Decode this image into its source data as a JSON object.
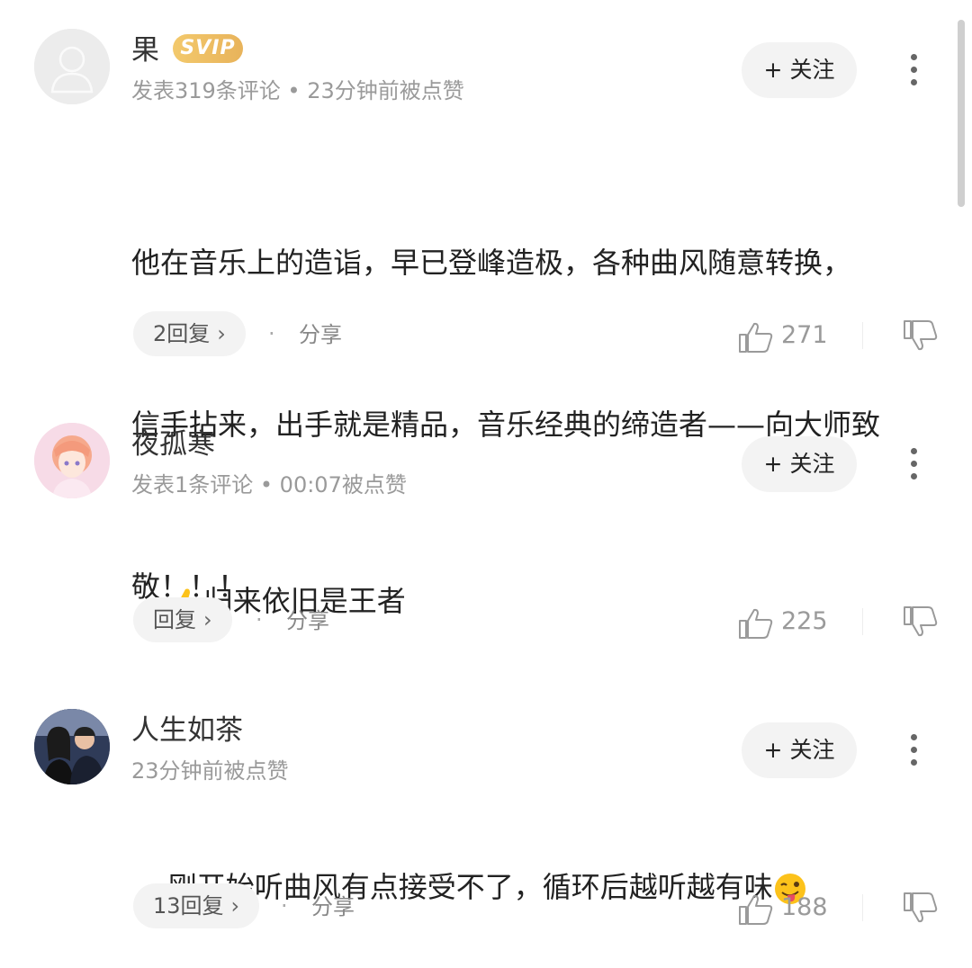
{
  "comments": [
    {
      "username": "果",
      "badge": "SVIP",
      "meta": "发表319条评论 • 23分钟前被点赞",
      "follow_label": "+ 关注",
      "text_lines": [
        "他在音乐上的造诣，早已登峰造极，各种曲风随意转换，",
        "信手拈来，出手就是精品，音乐经典的缔造者——向大师致",
        "敬！！！"
      ],
      "reply_label": "2回复",
      "share_label": "分享",
      "like_count": "271",
      "avatar": "default-avatar-icon"
    },
    {
      "username": "夜孤寒",
      "meta": "发表1条评论 • 00:07被点赞",
      "follow_label": "+ 关注",
      "emoji": "thumbs-up-emoji",
      "text": "归来依旧是王者",
      "reply_label": "回复",
      "share_label": "分享",
      "like_count": "225",
      "avatar": "anime-girl-avatar"
    },
    {
      "username": "人生如茶",
      "meta": "23分钟前被点赞",
      "follow_label": "+ 关注",
      "text": "刚开始听曲风有点接受不了，循环后越听越有味",
      "emoji": "winking-tongue-emoji",
      "reply_label": "13回复",
      "share_label": "分享",
      "like_count": "188",
      "avatar": "couple-photo-avatar"
    }
  ],
  "colors": {
    "svip_gold": "#e8b35b",
    "meta_gray": "#9a9a9a",
    "pill_bg": "#f3f3f3"
  }
}
